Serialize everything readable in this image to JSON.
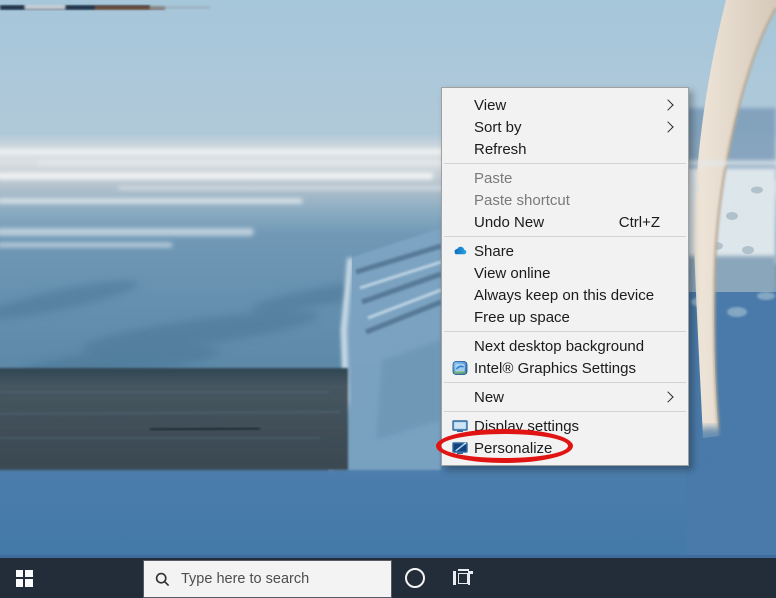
{
  "context_menu": {
    "items": [
      {
        "label": "View",
        "type": "submenu"
      },
      {
        "label": "Sort by",
        "type": "submenu"
      },
      {
        "label": "Refresh",
        "type": "normal"
      },
      {
        "type": "separator"
      },
      {
        "label": "Paste",
        "type": "disabled"
      },
      {
        "label": "Paste shortcut",
        "type": "disabled"
      },
      {
        "label": "Undo New",
        "shortcut": "Ctrl+Z",
        "type": "normal"
      },
      {
        "type": "separator"
      },
      {
        "label": "Share",
        "icon": "onedrive-cloud",
        "type": "normal"
      },
      {
        "label": "View online",
        "type": "normal"
      },
      {
        "label": "Always keep on this device",
        "type": "normal"
      },
      {
        "label": "Free up space",
        "type": "normal"
      },
      {
        "type": "separator"
      },
      {
        "label": "Next desktop background",
        "type": "normal"
      },
      {
        "label": "Intel® Graphics Settings",
        "icon": "intel-graphics",
        "type": "normal"
      },
      {
        "type": "separator"
      },
      {
        "label": "New",
        "type": "submenu"
      },
      {
        "type": "separator"
      },
      {
        "label": "Display settings",
        "icon": "display-monitor",
        "type": "normal"
      },
      {
        "label": "Personalize",
        "icon": "personalize-brush-monitor",
        "type": "normal",
        "annotated": true
      }
    ]
  },
  "taskbar": {
    "search_placeholder": "Type here to search"
  },
  "annotation": {
    "shape": "ellipse",
    "target": "Personalize menu item",
    "color": "#e11414"
  },
  "colors": {
    "taskbar_background": "#232d39",
    "taskbar_accent_line": "#3f6b9f",
    "menu_background": "#f2f2f2",
    "disabled_text": "#7a7a7a",
    "annotation_red": "#e11414",
    "onedrive_blue": "#1b79d1",
    "wallpaper_sky": "#a6c6da",
    "wallpaper_ice_blue": "#4a7aa9"
  }
}
